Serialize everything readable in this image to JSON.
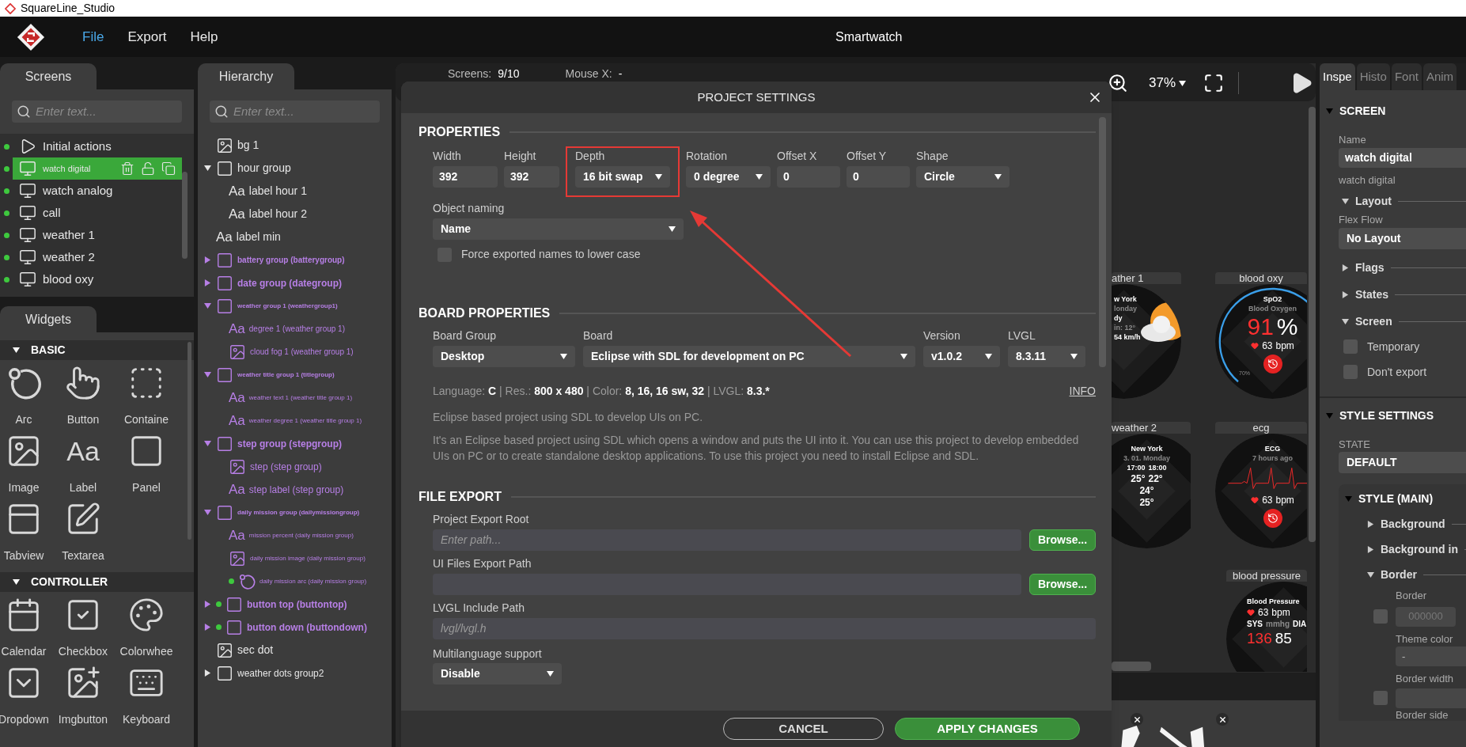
{
  "app_title": "SquareLine_Studio",
  "menu": [
    {
      "label": "File",
      "selected": true
    },
    {
      "label": "Export",
      "selected": false
    },
    {
      "label": "Help",
      "selected": false
    }
  ],
  "project_name": "Smartwatch",
  "screens_panel": {
    "tab": "Screens",
    "search_placeholder": "Enter text...",
    "items": [
      {
        "kind": "action",
        "label": "Initial actions",
        "selected": false
      },
      {
        "kind": "screen",
        "label": "watch digital",
        "selected": true
      },
      {
        "kind": "screen",
        "label": "watch analog",
        "selected": false
      },
      {
        "kind": "screen",
        "label": "call",
        "selected": false
      },
      {
        "kind": "screen",
        "label": "weather 1",
        "selected": false
      },
      {
        "kind": "screen",
        "label": "weather 2",
        "selected": false
      },
      {
        "kind": "screen",
        "label": "blood oxy",
        "selected": false
      }
    ]
  },
  "widgets_panel": {
    "tab": "Widgets",
    "categories": [
      {
        "title": "BASIC",
        "expanded": true,
        "items": [
          {
            "kind": "arc",
            "label": "Arc"
          },
          {
            "kind": "button",
            "label": "Button"
          },
          {
            "kind": "container",
            "label": "Containe"
          },
          {
            "kind": "image",
            "label": "Image"
          },
          {
            "kind": "label",
            "label": "Label",
            "glyph": "Aa"
          },
          {
            "kind": "panel",
            "label": "Panel"
          },
          {
            "kind": "tabview",
            "label": "Tabview"
          },
          {
            "kind": "textarea",
            "label": "Textarea"
          }
        ]
      },
      {
        "title": "CONTROLLER",
        "expanded": true,
        "items": [
          {
            "kind": "calendar",
            "label": "Calendar"
          },
          {
            "kind": "checkbox",
            "label": "Checkbox"
          },
          {
            "kind": "colorwheel",
            "label": "Colorwhee"
          },
          {
            "kind": "dropdown",
            "label": "Dropdown"
          },
          {
            "kind": "imgbutton",
            "label": "Imgbutton"
          },
          {
            "kind": "keyboard",
            "label": "Keyboard"
          }
        ]
      }
    ]
  },
  "hierarchy": {
    "tab": "Hierarchy",
    "search_placeholder": "Enter text...",
    "items": [
      {
        "kind": "image",
        "label": "bg 1",
        "color": "#e6e6e6",
        "bold": false,
        "dot": false
      },
      {
        "kind": "panel",
        "label": "hour group",
        "color": "#e6e6e6",
        "bold": false,
        "dot": false,
        "expanded": true,
        "children": [
          {
            "kind": "label",
            "glyph": "Aa",
            "label": "label hour 1",
            "color": "#e6e6e6",
            "bold": false,
            "dot": false
          },
          {
            "kind": "label",
            "glyph": "Aa",
            "label": "label hour 2",
            "color": "#e6e6e6",
            "bold": false,
            "dot": false
          }
        ]
      },
      {
        "kind": "label",
        "glyph": "Aa",
        "label": "label min",
        "color": "#e6e6e6",
        "bold": false,
        "dot": false
      },
      {
        "kind": "panel",
        "label": "battery group (batterygroup)",
        "color": "#b77fe6",
        "bold": true,
        "dot": false,
        "expanded": false
      },
      {
        "kind": "panel",
        "label": "date group (dategroup)",
        "color": "#b77fe6",
        "bold": true,
        "dot": false,
        "expanded": false
      },
      {
        "kind": "panel",
        "label": "weather group 1 (weathergroup1)",
        "color": "#b77fe6",
        "bold": true,
        "dot": false,
        "expanded": true,
        "children": [
          {
            "kind": "label",
            "glyph": "Aa",
            "label": "degree 1 (weather group 1)",
            "color": "#b77fe6",
            "bold": false,
            "dot": false
          },
          {
            "kind": "image",
            "label": "cloud fog 1 (weather group 1)",
            "color": "#b77fe6",
            "bold": false,
            "dot": false
          }
        ]
      },
      {
        "kind": "panel",
        "label": "weather title group 1 (titlegroup)",
        "color": "#b77fe6",
        "bold": true,
        "dot": false,
        "expanded": true,
        "children": [
          {
            "kind": "label",
            "glyph": "Aa",
            "label": "weather text 1 (weather title group 1)",
            "color": "#b77fe6",
            "bold": false,
            "dot": false
          },
          {
            "kind": "label",
            "glyph": "Aa",
            "label": "weather degree 1 (weather title group 1)",
            "color": "#b77fe6",
            "bold": false,
            "dot": false
          }
        ]
      },
      {
        "kind": "panel",
        "label": "step group (stepgroup)",
        "color": "#b77fe6",
        "bold": true,
        "dot": false,
        "expanded": true,
        "children": [
          {
            "kind": "image",
            "label": "step (step group)",
            "color": "#b77fe6",
            "bold": false,
            "dot": false
          },
          {
            "kind": "label",
            "glyph": "Aa",
            "label": "step label (step group)",
            "color": "#b77fe6",
            "bold": false,
            "dot": false
          }
        ]
      },
      {
        "kind": "panel",
        "label": "daily mission group (dailymissiongroup)",
        "color": "#b77fe6",
        "bold": true,
        "dot": false,
        "expanded": true,
        "children": [
          {
            "kind": "label",
            "glyph": "Aa",
            "label": "mission percent (daily mission group)",
            "color": "#b77fe6",
            "bold": false,
            "dot": false
          },
          {
            "kind": "image",
            "label": "daily mission image (daily mission group)",
            "color": "#b77fe6",
            "bold": false,
            "dot": false
          },
          {
            "kind": "arc",
            "label": "daily mission arc (daily mission group)",
            "color": "#b77fe6",
            "bold": false,
            "dot": true
          }
        ]
      },
      {
        "kind": "panel",
        "label": "button top (buttontop)",
        "color": "#b77fe6",
        "bold": true,
        "dot": true,
        "expanded": false
      },
      {
        "kind": "panel",
        "label": "button down (buttondown)",
        "color": "#b77fe6",
        "bold": true,
        "dot": true,
        "expanded": false
      },
      {
        "kind": "image",
        "label": "sec dot",
        "color": "#e6e6e6",
        "bold": false,
        "dot": false
      },
      {
        "kind": "panel",
        "label": "weather dots group2",
        "color": "#e6e6e6",
        "bold": false,
        "dot": false,
        "expanded": false
      }
    ]
  },
  "canvas": {
    "toolbar": {
      "screens_label": "Screens:",
      "screens_value": "9/10",
      "mouse_label": "Mouse X:",
      "mouse_value": "-",
      "zoom": "37%"
    },
    "thumbnails": [
      {
        "label": "ather 1",
        "kind": "weather",
        "lines": [
          {
            "kind": "caption",
            "parts": [
              {
                "text": "w York",
                "color": "#ffffff"
              }
            ]
          },
          {
            "kind": "caption",
            "parts": [
              {
                "text": "londay",
                "color": "#8a8a8a"
              }
            ]
          },
          {
            "kind": "caption",
            "parts": [
              {
                "text": "dy",
                "color": "#ffffff"
              }
            ]
          },
          {
            "kind": "caption",
            "parts": [
              {
                "text": "in: 12°",
                "color": "#8a8a8a"
              }
            ]
          },
          {
            "kind": "caption",
            "parts": [
              {
                "text": "54 km/h",
                "color": "#ffffff"
              }
            ]
          }
        ]
      },
      {
        "label": "blood oxy",
        "kind": "vitals",
        "ring_label": "70%",
        "lines": [
          {
            "kind": "caption",
            "parts": [
              {
                "text": "SpO2",
                "color": "#ffffff"
              }
            ]
          },
          {
            "kind": "caption",
            "parts": [
              {
                "text": "Blood Oxygen",
                "color": "#8a8a8a"
              }
            ]
          },
          {
            "kind": "value",
            "parts": [
              {
                "text": "91",
                "color": "#ff3030"
              },
              {
                "text": "%",
                "color": "#ffffff"
              }
            ]
          },
          {
            "kind": "pulse",
            "parts": [
              {
                "text": "63",
                "color": "#ffffff"
              },
              {
                "text": "bpm",
                "color": "#ffffff"
              }
            ]
          }
        ]
      },
      {
        "label": "weather 2",
        "kind": "forecast",
        "lines": [
          {
            "kind": "caption",
            "parts": [
              {
                "text": "New York",
                "color": "#ffffff"
              }
            ]
          },
          {
            "kind": "caption",
            "parts": [
              {
                "text": "3. 01. Monday",
                "color": "#8a8a8a"
              }
            ]
          },
          {
            "kind": "caption",
            "parts": [
              {
                "text": "17:00",
                "color": "#ffffff"
              },
              {
                "text": "18:00",
                "color": "#ffffff"
              }
            ]
          },
          {
            "kind": "reading",
            "parts": [
              {
                "text": "25°",
                "color": "#ffffff"
              },
              {
                "text": "22°",
                "color": "#ffffff"
              }
            ]
          },
          {
            "kind": "reading",
            "parts": [
              {
                "text": "24°",
                "color": "#ffffff"
              }
            ]
          },
          {
            "kind": "reading",
            "parts": [
              {
                "text": "25°",
                "color": "#ffffff"
              }
            ]
          }
        ]
      },
      {
        "label": "ecg",
        "kind": "ecg",
        "lines": [
          {
            "kind": "caption",
            "parts": [
              {
                "text": "ECG",
                "color": "#ffffff"
              }
            ]
          },
          {
            "kind": "caption",
            "parts": [
              {
                "text": "7 hours ago",
                "color": "#8a8a8a"
              }
            ]
          },
          {
            "kind": "pulse",
            "parts": [
              {
                "text": "63",
                "color": "#ffffff"
              },
              {
                "text": "bpm",
                "color": "#ffffff"
              }
            ]
          }
        ]
      },
      {
        "label": "blood pressure",
        "kind": "pressure",
        "lines": [
          {
            "kind": "caption",
            "parts": [
              {
                "text": "Blood Pressure",
                "color": "#ffffff"
              }
            ]
          },
          {
            "kind": "pulse",
            "parts": [
              {
                "text": "63",
                "color": "#ffffff"
              },
              {
                "text": "bpm",
                "color": "#ffffff"
              }
            ]
          },
          {
            "kind": "reading",
            "parts": [
              {
                "text": "SYS",
                "color": "#ffffff"
              },
              {
                "text": "mmhg",
                "color": "#8a8a8a"
              },
              {
                "text": "DIA",
                "color": "#ffffff"
              }
            ]
          },
          {
            "kind": "value",
            "parts": [
              {
                "text": "136",
                "color": "#ff3030"
              },
              {
                "text": "85",
                "color": "#ffffff"
              }
            ]
          }
        ]
      }
    ]
  },
  "dialog": {
    "title": "PROJECT SETTINGS",
    "properties": {
      "heading": "PROPERTIES",
      "fields": [
        {
          "kind": "input",
          "label": "Width",
          "value": "392",
          "highlighted": false
        },
        {
          "kind": "input",
          "label": "Height",
          "value": "392",
          "highlighted": false
        },
        {
          "kind": "select",
          "label": "Depth",
          "value": "16 bit swap",
          "highlighted": true
        },
        {
          "kind": "select",
          "label": "Rotation",
          "value": "0 degree",
          "highlighted": false
        },
        {
          "kind": "input",
          "label": "Offset X",
          "value": "0",
          "highlighted": false
        },
        {
          "kind": "input",
          "label": "Offset Y",
          "value": "0",
          "highlighted": false
        },
        {
          "kind": "select",
          "label": "Shape",
          "value": "Circle",
          "highlighted": false
        }
      ],
      "naming": {
        "label": "Object naming",
        "value": "Name"
      },
      "force_lower": {
        "label": "Force exported names to lower case",
        "checked": false
      }
    },
    "board": {
      "heading": "BOARD PROPERTIES",
      "fields": [
        {
          "label": "Board Group",
          "value": "Desktop"
        },
        {
          "label": "Board",
          "value": "Eclipse with SDL for development on PC"
        },
        {
          "label": "Version",
          "value": "v1.0.2"
        },
        {
          "label": "LVGL",
          "value": "8.3.11"
        }
      ],
      "info": [
        {
          "label": "Language:",
          "value": "C"
        },
        {
          "label": "| Res.:",
          "value": "800 x 480"
        },
        {
          "label": "| Color:",
          "value": "8, 16, 16 sw, 32"
        },
        {
          "label": "| LVGL:",
          "value": "8.3.*"
        }
      ],
      "info_link": "INFO",
      "short_desc": "Eclipse based project using SDL to develop UIs on PC.",
      "long_desc": "It's an Eclipse based project using SDL which opens a window and puts the UI into it. You can use this project to develop embedded UIs on PC or to create standalone desktop applications. To use this project you need to install Eclipse and SDL."
    },
    "file_export": {
      "heading": "FILE EXPORT",
      "paths": [
        {
          "label": "Project Export Root",
          "placeholder": "Enter path...",
          "browse": "Browse..."
        },
        {
          "label": "UI Files Export Path",
          "browse": "Browse..."
        },
        {
          "label": "LVGL Include Path",
          "placeholder": "lvgl/lvgl.h"
        }
      ],
      "multilang": {
        "label": "Multilanguage support",
        "value": "Disable"
      }
    },
    "buttons": [
      {
        "kind": "secondary",
        "label": "CANCEL"
      },
      {
        "kind": "primary",
        "label": "APPLY CHANGES"
      }
    ],
    "annotation": {
      "kind": "arrow"
    }
  },
  "inspector": {
    "tabs": [
      {
        "label": "Inspe",
        "selected": true
      },
      {
        "label": "Histo",
        "selected": false
      },
      {
        "label": "Font",
        "selected": false
      },
      {
        "label": "Anim",
        "selected": false
      }
    ],
    "screen_section": {
      "title": "SCREEN",
      "expanded": true,
      "name_label": "Name",
      "name_value": "watch digital",
      "name_caption": "watch digital",
      "layout": {
        "title": "Layout",
        "expanded": true,
        "label": "Flex Flow",
        "value": "No Layout"
      },
      "groups": [
        {
          "title": "Flags",
          "expanded": false
        },
        {
          "title": "States",
          "expanded": false
        }
      ],
      "screen_group": {
        "title": "Screen",
        "expanded": true,
        "options": [
          {
            "label": "Temporary",
            "checked": false
          },
          {
            "label": "Don't export",
            "checked": false
          }
        ]
      }
    },
    "style_settings": {
      "title": "STYLE SETTINGS",
      "expanded": true,
      "state_label": "STATE",
      "state_value": "DEFAULT",
      "style_main": {
        "title": "STYLE (MAIN)",
        "expanded": true,
        "groups": [
          {
            "title": "Background",
            "expanded": false
          },
          {
            "title": "Background in",
            "expanded": false
          },
          {
            "title": "Border",
            "expanded": true
          }
        ],
        "border": {
          "color_label": "Border",
          "color_value": "000000",
          "color_checked": false,
          "theme_label": "Theme color",
          "theme_value": "-",
          "width_label": "Border width",
          "width_checked": false,
          "side_label": "Border side"
        }
      }
    }
  }
}
